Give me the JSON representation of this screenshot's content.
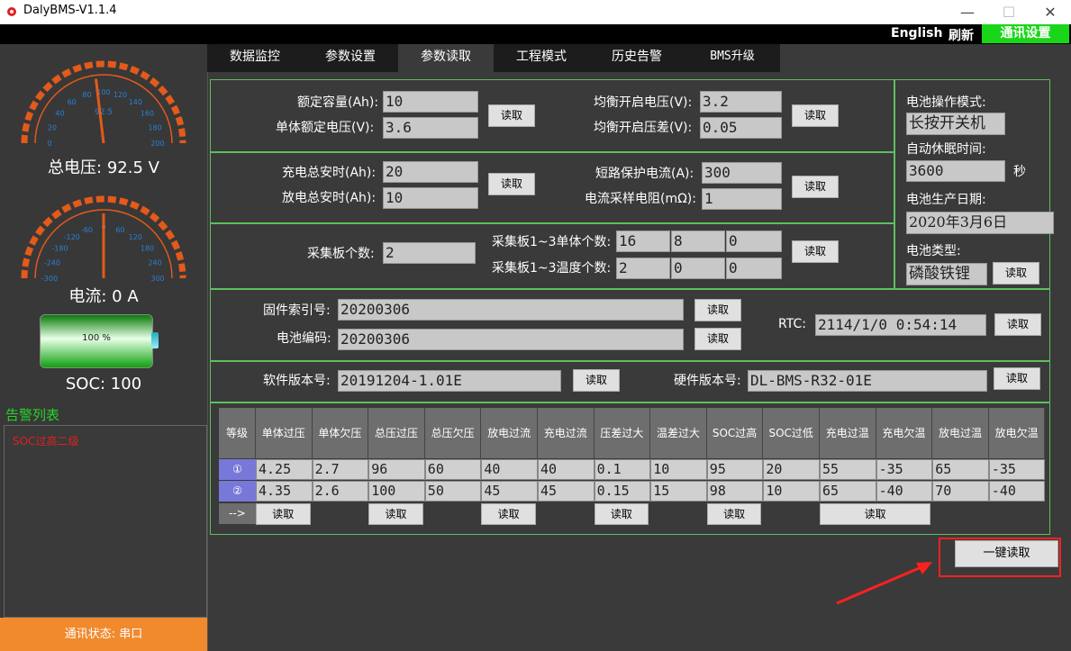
{
  "window": {
    "title": "DalyBMS-V1.1.4",
    "minimize": "—",
    "maximize": "☐",
    "close": "✕"
  },
  "topbar": {
    "english": "English",
    "refresh": "刷新",
    "comm_settings": "通讯设置"
  },
  "sidebar": {
    "voltage_gauge": {
      "ticks": [
        "0",
        "20",
        "40",
        "60",
        "80",
        "100",
        "120",
        "140",
        "160",
        "180",
        "200"
      ],
      "value": 92.5,
      "center_text": "92.5",
      "label": "总电压: 92.5 V"
    },
    "current_gauge": {
      "ticks": [
        "-300",
        "-240",
        "-180",
        "-120",
        "-60",
        "0",
        "60",
        "120",
        "180",
        "240",
        "300"
      ],
      "value": 0,
      "center_text": "0",
      "label": "电流: 0 A"
    },
    "battery": {
      "percent_text": "100 %",
      "soc_label": "SOC: 100",
      "level": 100
    },
    "alarm_title": "告警列表",
    "alarm_items": [
      "SOC过高二级"
    ],
    "comm_status": "通讯状态: 串口"
  },
  "tabs": [
    "数据监控",
    "参数设置",
    "参数读取",
    "工程模式",
    "历史告警",
    "BMS升级"
  ],
  "panel1": {
    "rated_capacity_label": "额定容量(Ah):",
    "rated_capacity": "10",
    "cell_rated_voltage_label": "单体额定电压(V):",
    "cell_rated_voltage": "3.6",
    "balance_on_voltage_label": "均衡开启电压(V):",
    "balance_on_voltage": "3.2",
    "balance_on_diff_label": "均衡开启压差(V):",
    "balance_on_diff": "0.05"
  },
  "panel2": {
    "charge_ah_label": "充电总安时(Ah):",
    "charge_ah": "20",
    "discharge_ah_label": "放电总安时(Ah):",
    "discharge_ah": "10",
    "short_circuit_label": "短路保护电流(A):",
    "short_circuit": "300",
    "sample_res_label": "电流采样电阻(mΩ):",
    "sample_res": "1"
  },
  "panel3": {
    "board_count_label": "采集板个数:",
    "board_count": "2",
    "cell_count_label": "采集板1~3单体个数:",
    "cell_counts": [
      "16",
      "8",
      "0"
    ],
    "temp_count_label": "采集板1~3温度个数:",
    "temp_counts": [
      "2",
      "0",
      "0"
    ]
  },
  "panel4": {
    "firmware_label": "固件索引号:",
    "firmware": "20200306",
    "battery_code_label": "电池编码:",
    "battery_code": "20200306",
    "rtc_label": "RTC:",
    "rtc": "2114/1/0 0:54:14"
  },
  "panel5": {
    "software_label": "软件版本号:",
    "software": "20191204-1.01E",
    "hardware_label": "硬件版本号:",
    "hardware": "DL-BMS-R32-01E"
  },
  "right_panel": {
    "op_mode_label": "电池操作模式:",
    "op_mode": "长按开关机",
    "sleep_label": "自动休眠时间:",
    "sleep": "3600",
    "sleep_unit": "秒",
    "prod_date_label": "电池生产日期:",
    "prod_date": "2020年3月6日",
    "type_label": "电池类型:",
    "type": "磷酸铁锂"
  },
  "table": {
    "level_label": "等级",
    "headers": [
      "单体过压",
      "单体欠压",
      "总压过压",
      "总压欠压",
      "放电过流",
      "充电过流",
      "压差过大",
      "温差过大",
      "SOC过高",
      "SOC过低",
      "充电过温",
      "充电欠温",
      "放电过温",
      "放电欠温"
    ],
    "row1_num": "①",
    "row1": [
      "4.25",
      "2.7",
      "96",
      "60",
      "40",
      "40",
      "0.1",
      "10",
      "95",
      "20",
      "55",
      "-35",
      "65",
      "-35"
    ],
    "row2_num": "②",
    "row2": [
      "4.35",
      "2.6",
      "100",
      "50",
      "45",
      "45",
      "0.15",
      "15",
      "98",
      "10",
      "65",
      "-40",
      "70",
      "-40"
    ],
    "arrow": "-->"
  },
  "read_label": "读取",
  "read_all": "一键读取"
}
